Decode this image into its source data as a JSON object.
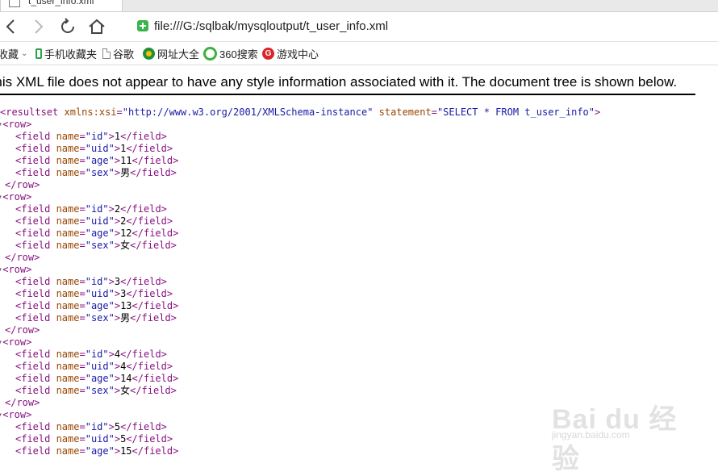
{
  "tab": {
    "title": "t_user_info.xml"
  },
  "nav": {
    "url": "file:///G:/sqlbak/mysqloutput/t_user_info.xml"
  },
  "bookmarks": [
    {
      "label": "收藏",
      "icon": "chevron-down-icon"
    },
    {
      "label": "手机收藏夹",
      "icon": "phone-icon"
    },
    {
      "label": "谷歌",
      "icon": "page-icon"
    },
    {
      "label": "网址大全",
      "icon": "compass-icon"
    },
    {
      "label": "360搜索",
      "icon": "search-icon"
    },
    {
      "label": "游戏中心",
      "icon": "game-icon"
    }
  ],
  "xml": {
    "notice": "This XML file does not appear to have any style information associated with it. The document tree is shown below.",
    "root_tag": "resultset",
    "root_attr1_name": "xmlns:xsi",
    "root_attr1_value": "\"http://www.w3.org/2001/XMLSchema-instance\"",
    "root_attr2_name": "statement",
    "root_attr2_value": "\"SELECT * FROM t_user_info\"",
    "rows": [
      {
        "fields": [
          {
            "name": "\"id\"",
            "value": "1"
          },
          {
            "name": "\"uid\"",
            "value": "1"
          },
          {
            "name": "\"age\"",
            "value": "11"
          },
          {
            "name": "\"sex\"",
            "value": "男"
          }
        ]
      },
      {
        "fields": [
          {
            "name": "\"id\"",
            "value": "2"
          },
          {
            "name": "\"uid\"",
            "value": "2"
          },
          {
            "name": "\"age\"",
            "value": "12"
          },
          {
            "name": "\"sex\"",
            "value": "女"
          }
        ]
      },
      {
        "fields": [
          {
            "name": "\"id\"",
            "value": "3"
          },
          {
            "name": "\"uid\"",
            "value": "3"
          },
          {
            "name": "\"age\"",
            "value": "13"
          },
          {
            "name": "\"sex\"",
            "value": "男"
          }
        ]
      },
      {
        "fields": [
          {
            "name": "\"id\"",
            "value": "4"
          },
          {
            "name": "\"uid\"",
            "value": "4"
          },
          {
            "name": "\"age\"",
            "value": "14"
          },
          {
            "name": "\"sex\"",
            "value": "女"
          }
        ]
      },
      {
        "fields": [
          {
            "name": "\"id\"",
            "value": "5"
          },
          {
            "name": "\"uid\"",
            "value": "5"
          },
          {
            "name": "\"age\"",
            "value": "15"
          }
        ]
      }
    ]
  },
  "watermark": {
    "main": "Bai du 经验",
    "sub": "jingyan.baidu.com"
  }
}
